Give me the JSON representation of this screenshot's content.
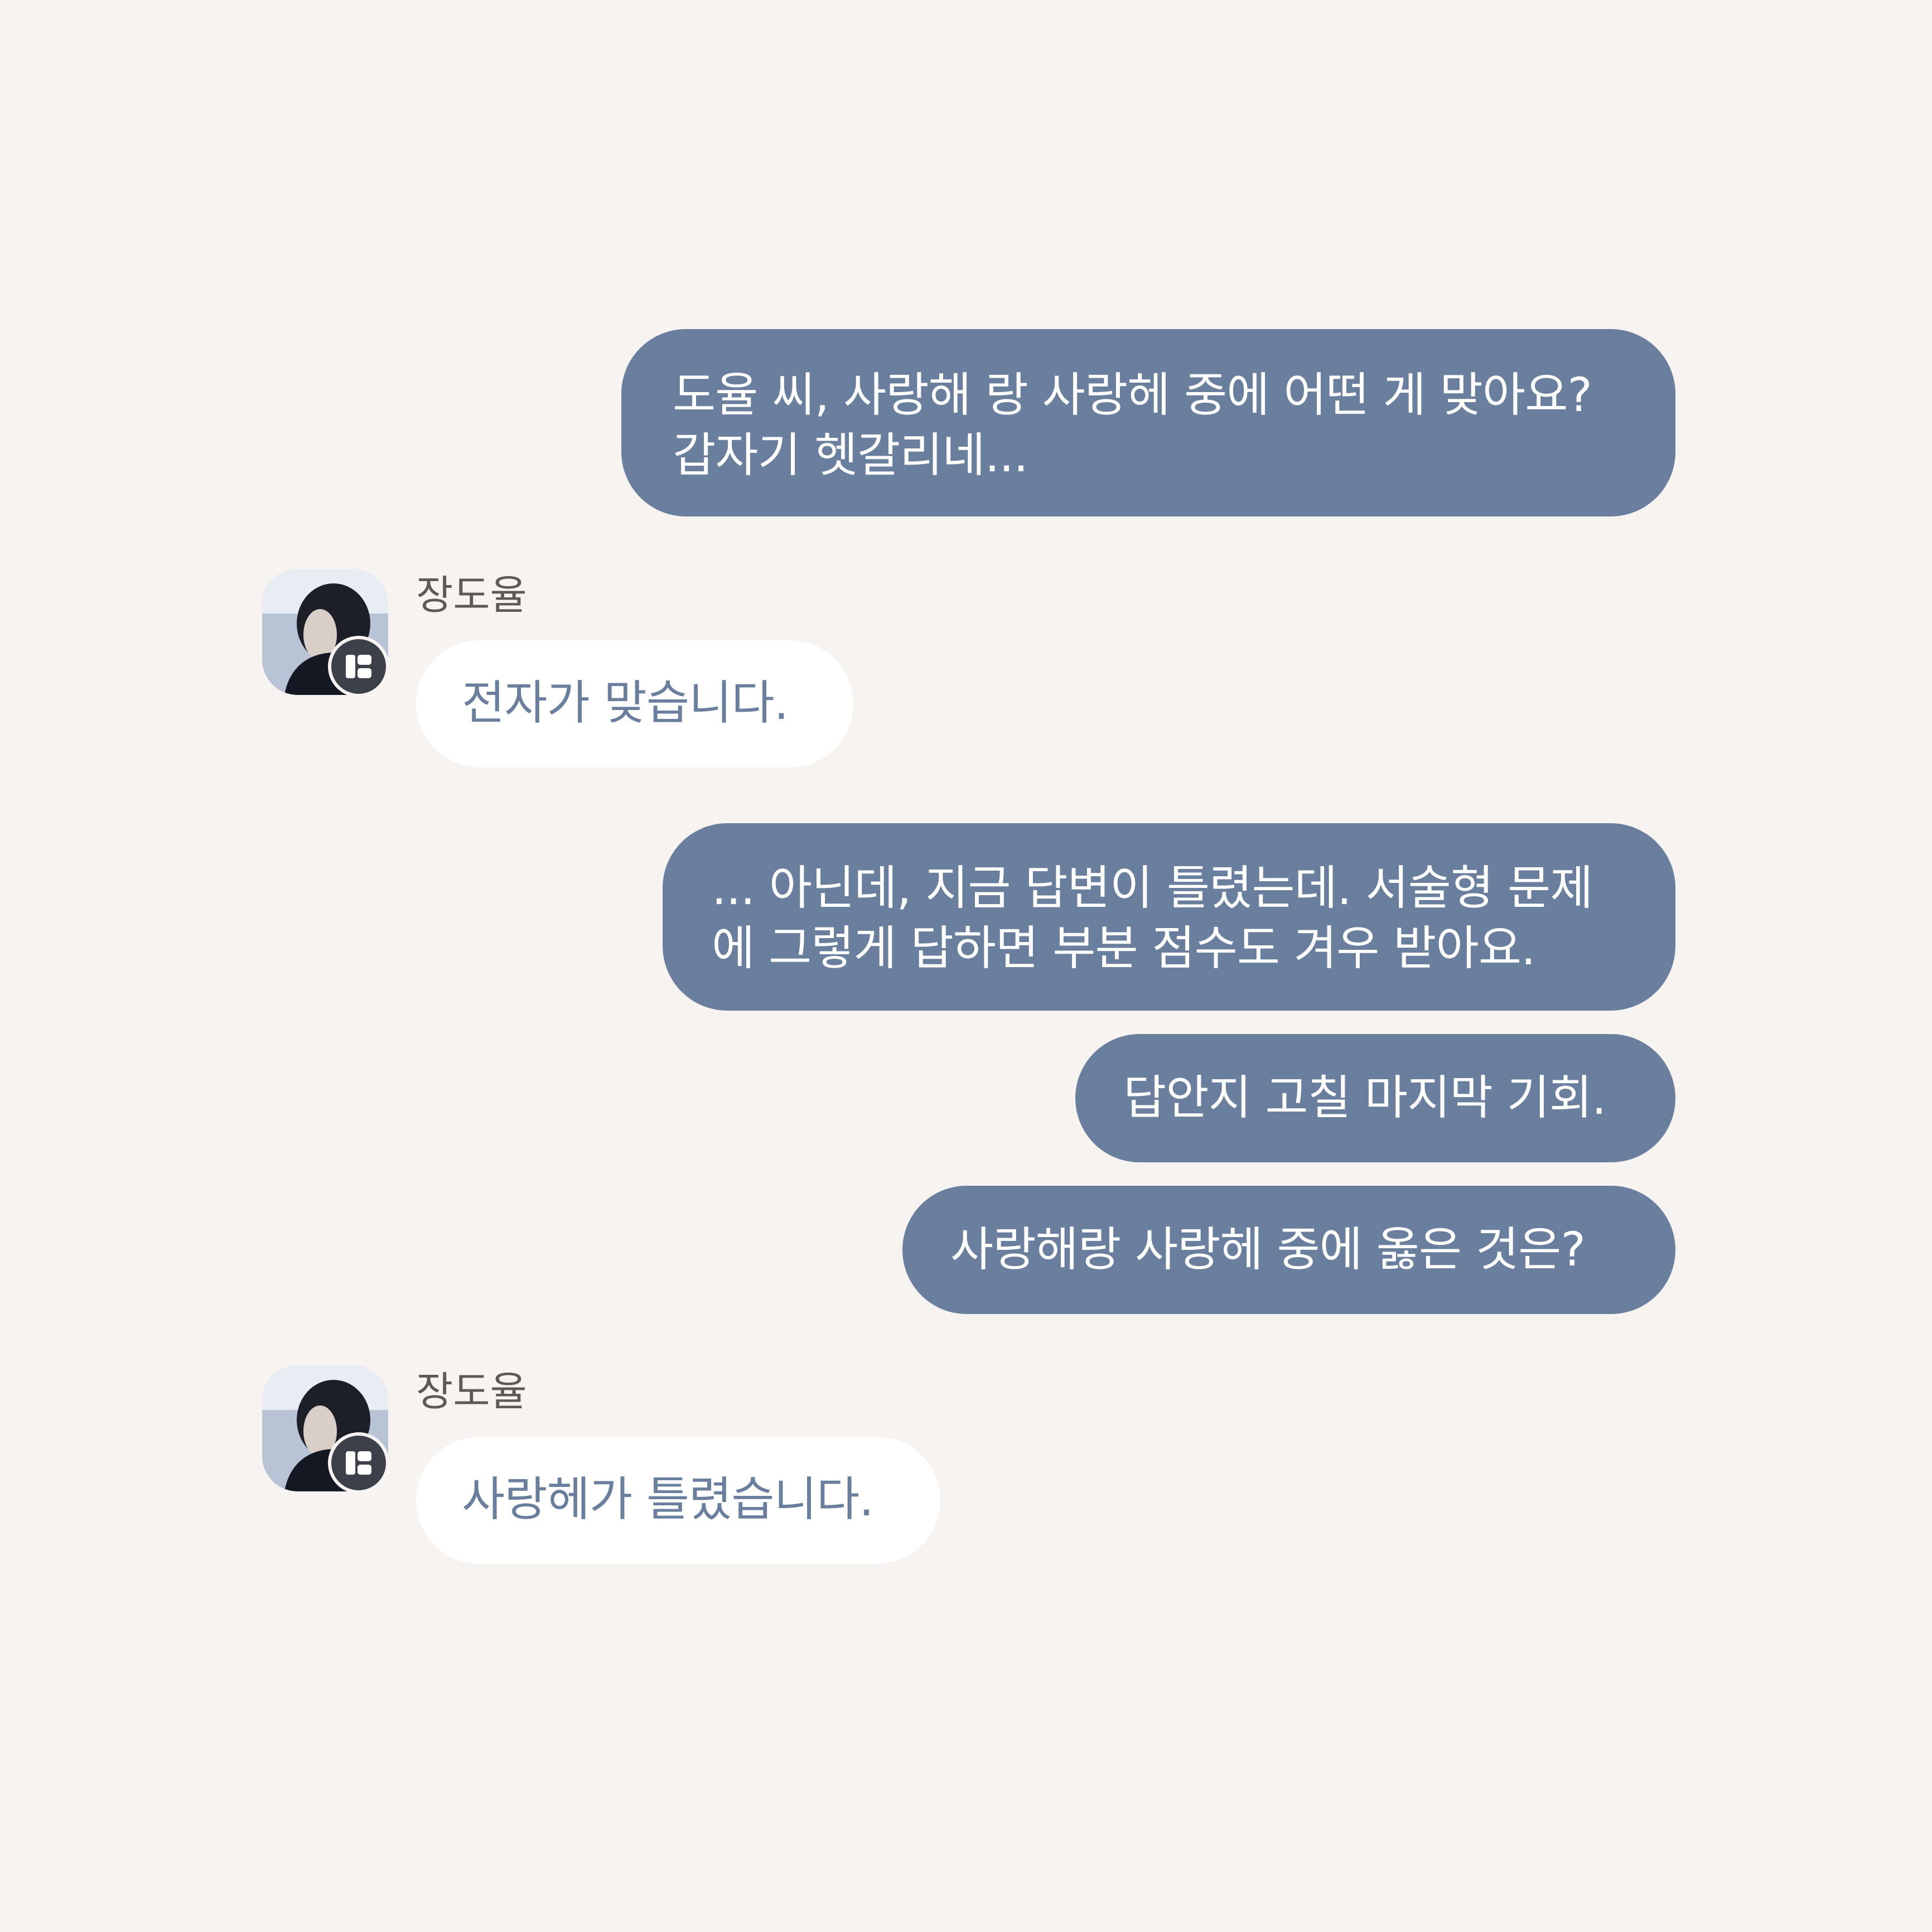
{
  "messages": [
    {
      "side": "out",
      "text": "도율 씨, 사랑해 랑 사랑헤 중에 어떤 게 맞아요?\n갑자기 헷갈리네..."
    },
    {
      "side": "in",
      "sender": "장도율",
      "text": "전자가 맞습니다."
    },
    {
      "side": "out",
      "text": "... 아닌데, 지금 답변이 틀렸는데. 서술형 문제\n에 그렇게 답하면 부분 점수도 겨우 받아요."
    },
    {
      "side": "out",
      "text": "답안지 고칠 마지막 기회."
    },
    {
      "side": "out",
      "text": "사랑해랑 사랑헤 중에 옳은 것은?"
    },
    {
      "side": "in",
      "sender": "장도율",
      "text": "사랑헤가 틀렸습니다."
    }
  ],
  "colors": {
    "background": "#f7f3f1",
    "outgoing_bubble": "#6a7f9e",
    "incoming_bubble": "#ffffff",
    "incoming_text": "#6a7f9e"
  },
  "icons": {
    "avatar_badge": "app-badge-icon"
  }
}
